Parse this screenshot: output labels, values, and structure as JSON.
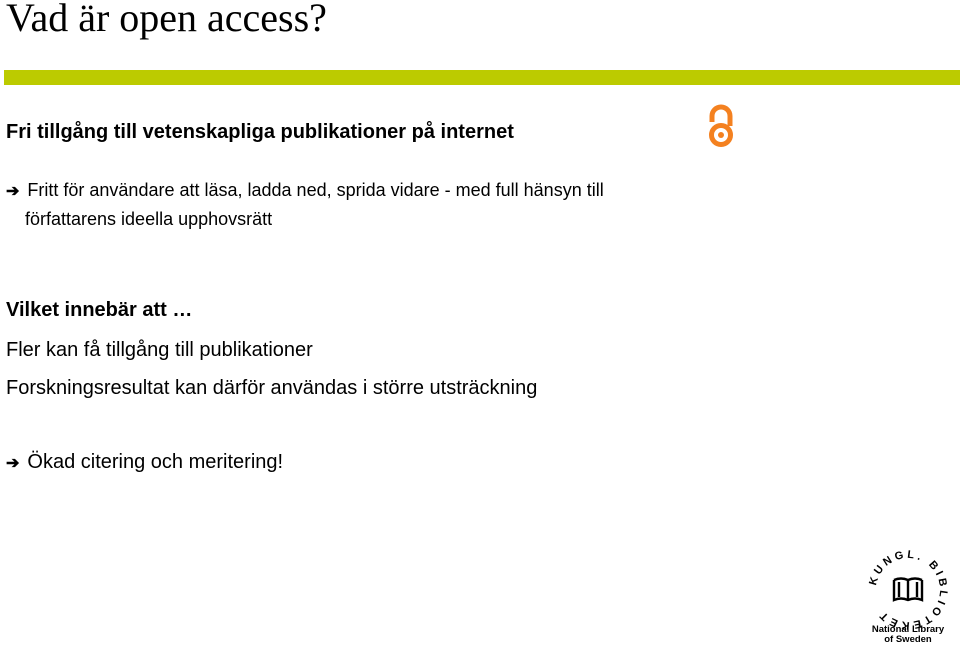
{
  "slide": {
    "title": "Vad är open access?",
    "accent_color": "#bccb00",
    "subtitle": "Fri tillgång till vetenskapliga publikationer på internet",
    "subtitle_icon": "open-access-icon",
    "subtitle_icon_color": "#f48120",
    "bullets": [
      {
        "icon": "arrow-right-icon",
        "arrow_glyph": "➔",
        "line1": "Fritt för användare att läsa, ladda ned, sprida vidare - med full hänsyn till",
        "line2": "författarens ideella upphovsrätt"
      }
    ],
    "section_heading": "Vilket innebär att …",
    "points": [
      "Fler kan få tillgång till publikationer",
      "Forskningsresultat kan därför användas i större utsträckning"
    ],
    "conclusion": {
      "icon": "arrow-right-icon",
      "arrow_glyph": "➔",
      "text": "Ökad citering och meritering!"
    }
  },
  "logo": {
    "ring_text": "KUNGL. BIBLIOTEKET",
    "caption_line1": "National Library",
    "caption_line2": "of Sweden"
  }
}
